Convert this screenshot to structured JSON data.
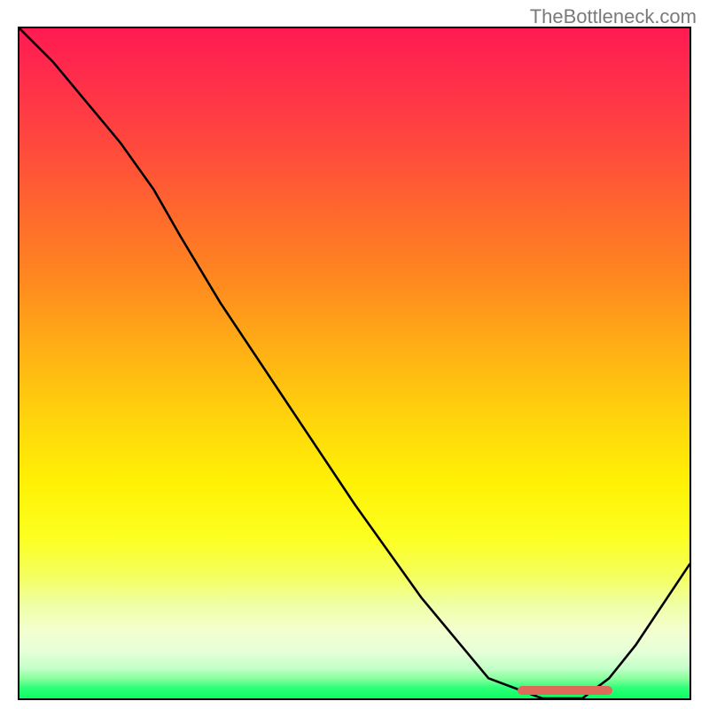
{
  "watermark": "TheBottleneck.com",
  "colors": {
    "gradient_top": "#ff1a52",
    "gradient_mid": "#ffd30c",
    "gradient_bottom": "#0aff60",
    "curve": "#000000",
    "segment": "#e06a5a"
  },
  "chart_data": {
    "type": "line",
    "title": "",
    "xlabel": "",
    "ylabel": "",
    "xlim": [
      0,
      100
    ],
    "ylim": [
      0,
      100
    ],
    "x": [
      0,
      5,
      10,
      15,
      20,
      24,
      30,
      40,
      50,
      60,
      70,
      78,
      84,
      88,
      92,
      100
    ],
    "values": [
      100,
      95,
      89,
      83,
      76,
      69,
      59,
      44,
      29,
      15,
      3,
      0,
      0,
      3,
      8,
      20
    ],
    "segment": {
      "x_start": 74,
      "x_end": 88,
      "y": 0
    }
  }
}
